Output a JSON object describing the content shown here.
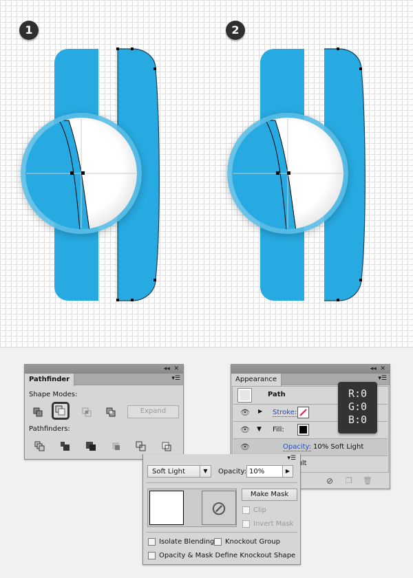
{
  "steps": [
    "1",
    "2"
  ],
  "colors": {
    "shape_blue": "#27aae1",
    "panel_bg": "#d6d6d6",
    "tooltip_bg": "#333333",
    "link_blue": "#1a4fd0"
  },
  "pathfinder": {
    "title": "Pathfinder",
    "shape_modes_label": "Shape Modes:",
    "shape_modes": [
      "unite-icon",
      "minus-front-icon",
      "intersect-icon",
      "exclude-icon"
    ],
    "selected_mode": "minus-front-icon",
    "expand_label": "Expand",
    "pathfinders_label": "Pathfinders:",
    "pathfinders": [
      "divide-icon",
      "trim-icon",
      "merge-icon",
      "crop-icon",
      "outline-icon",
      "minus-back-icon"
    ]
  },
  "appearance": {
    "title": "Appearance",
    "object": "Path",
    "stroke_label": "Stroke:",
    "fill_label": "Fill:",
    "opacity_label": "Opacity:",
    "opacity_value": "10% Soft Light",
    "default_text": "Default"
  },
  "tooltip": {
    "r": "R:0",
    "g": "G:0",
    "b": "B:0"
  },
  "transparency": {
    "blend_mode": "Soft Light",
    "opacity_label": "Opacity:",
    "opacity_value": "10%",
    "make_mask": "Make Mask",
    "clip": "Clip",
    "invert_mask": "Invert Mask",
    "isolate_blending": "Isolate Blending",
    "knockout_group": "Knockout Group",
    "opacity_mask_knockout": "Opacity & Mask Define Knockout Shape"
  }
}
